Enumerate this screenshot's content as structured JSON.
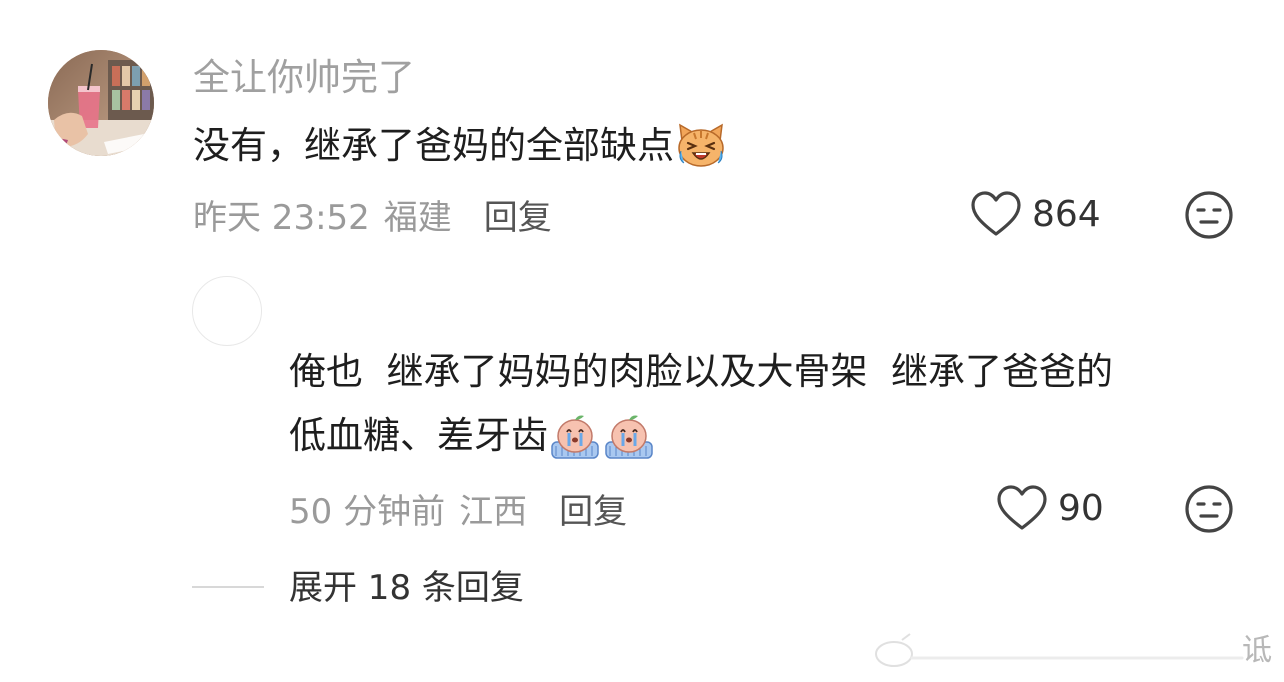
{
  "comment": {
    "username": "全让你帅完了",
    "text": "没有，继承了爸妈的全部缺点",
    "emoji": "crying-cat-emoji",
    "time": "昨天 23:52",
    "location": "福建",
    "reply_label": "回复",
    "like_count": "864"
  },
  "reply": {
    "text_line1": "俺也  继承了妈妈的肉脸以及大骨架  继承了爸爸的",
    "text_line2": "低血糖、差牙齿",
    "emoji": "crying-peach-emoji",
    "time": "50 分钟前",
    "location": "江西",
    "reply_label": "回复",
    "like_count": "90"
  },
  "expand": {
    "label": "展开 18 条回复"
  },
  "watermark": {
    "text": "诋"
  },
  "colors": {
    "secondary_text": "#9a9a9a",
    "primary_text": "#1e1e1e",
    "icon_stroke": "#555555"
  }
}
